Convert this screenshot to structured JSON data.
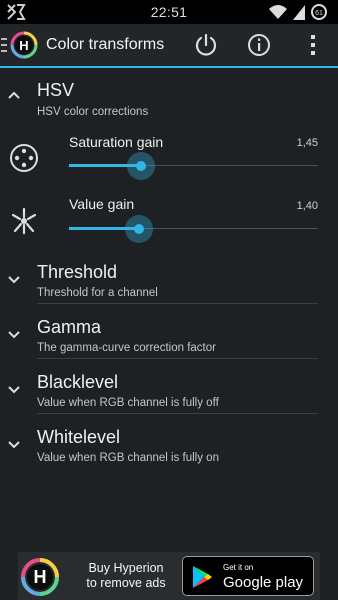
{
  "status": {
    "time": "22:51",
    "battery": "61"
  },
  "app": {
    "title": "Color transforms"
  },
  "sections": [
    {
      "title": "HSV",
      "subtitle": "HSV color corrections",
      "expanded": true
    },
    {
      "title": "Threshold",
      "subtitle": "Threshold for a channel",
      "expanded": false
    },
    {
      "title": "Gamma",
      "subtitle": "The gamma-curve correction factor",
      "expanded": false
    },
    {
      "title": "Blacklevel",
      "subtitle": "Value when RGB channel is fully off",
      "expanded": false
    },
    {
      "title": "Whitelevel",
      "subtitle": "Value when RGB channel is fully on",
      "expanded": false
    }
  ],
  "sliders": [
    {
      "label": "Saturation gain",
      "value_text": "1,45",
      "level": 0.29
    },
    {
      "label": "Value gain",
      "value_text": "1,40",
      "level": 0.28
    }
  ],
  "ad": {
    "text_line1": "Buy Hyperion",
    "text_line2": "to remove ads",
    "store_small": "Get it on",
    "store_big": "Google play"
  },
  "colors": {
    "accent": "#33b5e5",
    "background": "#1e2124"
  },
  "icons": [
    "notification-icon",
    "wifi-icon",
    "signal-icon",
    "battery-icon",
    "menu-icon",
    "app-logo-icon",
    "power-icon",
    "info-icon",
    "overflow-menu-icon",
    "chevron-up-icon",
    "chevron-down-icon",
    "saturation-icon",
    "brightness-icon",
    "google-play-icon"
  ]
}
